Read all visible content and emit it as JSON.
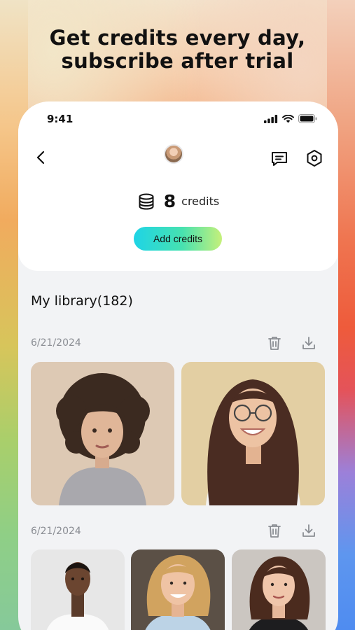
{
  "headline": {
    "line1": "Get credits every day,",
    "line2": "subscribe after trial"
  },
  "status_bar": {
    "time": "9:41",
    "icons": [
      "signal-icon",
      "wifi-icon",
      "battery-icon"
    ]
  },
  "nav": {
    "back_icon": "chevron-left-icon",
    "chat_icon": "message-icon",
    "settings_icon": "hexagon-settings-icon"
  },
  "credits": {
    "icon": "coins-stack-icon",
    "count": "8",
    "label": "credits",
    "add_button": "Add credits"
  },
  "library": {
    "title": "My library(182)",
    "groups": [
      {
        "date": "6/21/2024",
        "photos": 2
      },
      {
        "date": "6/21/2024",
        "photos": 3
      }
    ]
  },
  "colors": {
    "accent_start": "#1ed4e6",
    "accent_end": "#c6f07a",
    "screen_bg": "#f2f3f5",
    "card_bg": "#ffffff",
    "muted_text": "#8a8d93"
  }
}
